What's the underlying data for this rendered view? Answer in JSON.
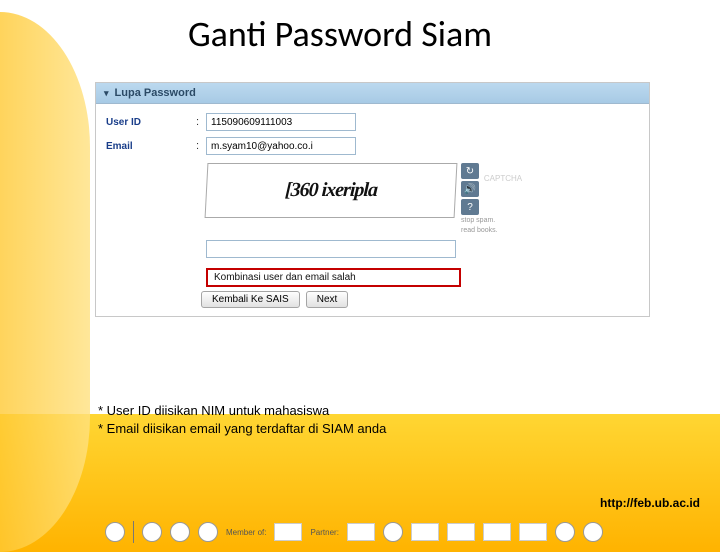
{
  "title": "Ganti Password Siam",
  "window": {
    "header": "Lupa Password"
  },
  "fields": {
    "userid_label": "User ID",
    "userid_value": "115090609111003",
    "email_label": "Email",
    "email_value": "m.syam10@yahoo.co.i"
  },
  "captcha": {
    "image_text": "[360  ixeripla",
    "brand": "CAPTCHA",
    "info1": "stop spam.",
    "info2": "read books."
  },
  "error": "Kombinasi user dan email salah",
  "buttons": {
    "back": "Kembali Ke SAIS",
    "next": "Next"
  },
  "notes": {
    "line1": "* User ID diisikan NIM untuk mahasiswa",
    "line2": "* Email diisikan email yang terdaftar di SIAM anda"
  },
  "footer": {
    "url": "http://feb.ub.ac.id",
    "memberof": "Member of:",
    "partner": "Partner:"
  }
}
